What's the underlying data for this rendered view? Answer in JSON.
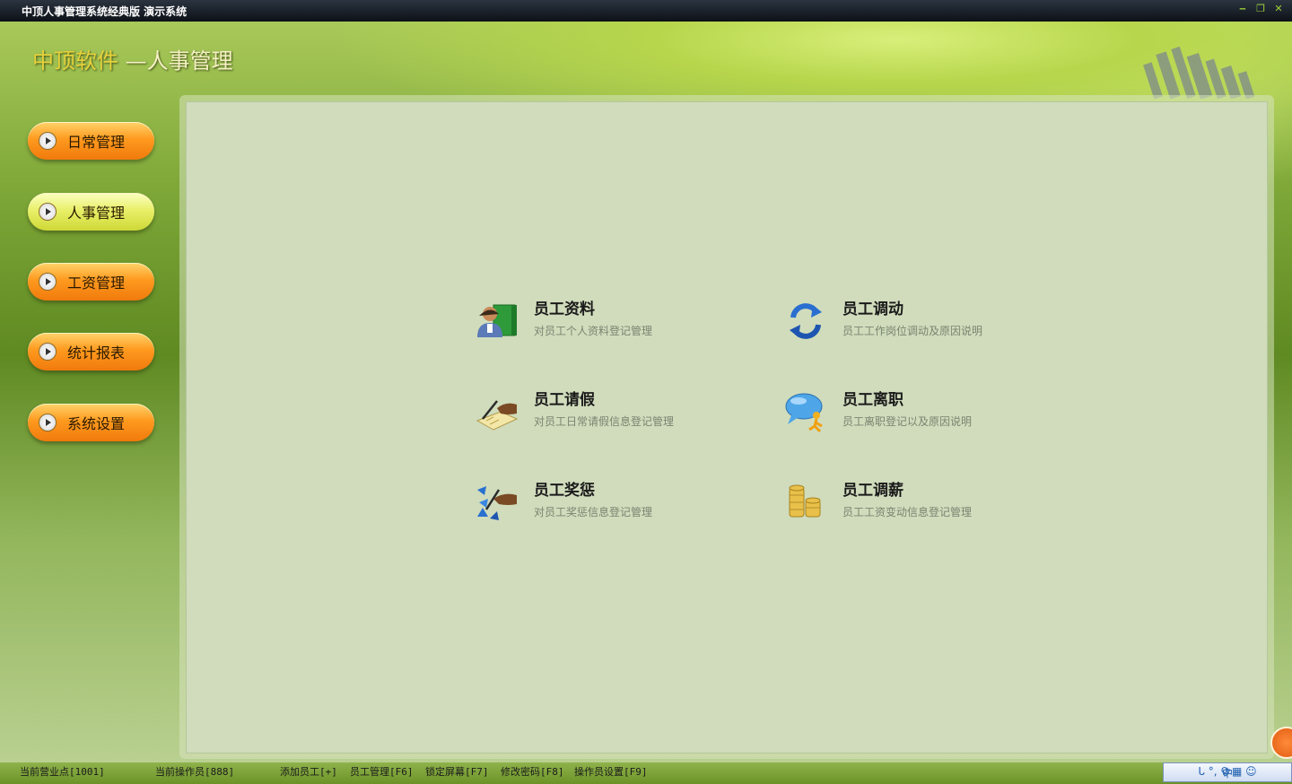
{
  "window": {
    "title": "中顶人事管理系统经典版 演示系统",
    "controls": [
      "‒",
      "❐",
      "✕"
    ]
  },
  "brand": {
    "part1": "中顶软件",
    "part2": " —人事管理"
  },
  "sidebar": {
    "items": [
      {
        "label": "日常管理"
      },
      {
        "label": "人事管理"
      },
      {
        "label": "工资管理"
      },
      {
        "label": "统计报表"
      },
      {
        "label": "系统设置"
      }
    ]
  },
  "modules": [
    {
      "title": "员工资料",
      "desc": "对员工个人资料登记管理",
      "icon": "employee-profile-icon"
    },
    {
      "title": "员工调动",
      "desc": "员工工作岗位调动及原因说明",
      "icon": "refresh-arrows-icon"
    },
    {
      "title": "员工请假",
      "desc": "对员工日常请假信息登记管理",
      "icon": "writing-hand-icon"
    },
    {
      "title": "员工离职",
      "desc": "员工离职登记以及原因说明",
      "icon": "chat-person-icon"
    },
    {
      "title": "员工奖惩",
      "desc": "对员工奖惩信息登记管理",
      "icon": "award-arrows-icon"
    },
    {
      "title": "员工调薪",
      "desc": "员工工资变动信息登记管理",
      "icon": "coins-icon"
    }
  ],
  "statusbar": {
    "outlet": "当前营业点[1001]",
    "operator": "当前操作员[888]",
    "add_employee": "添加员工[+]",
    "manage_employee": "员工管理[F6]",
    "lock_screen": "锁定屏幕[F7]",
    "change_password": "修改密码[F8]",
    "operator_settings": "操作员设置[F9]",
    "ime": {
      "mode": "中",
      "glyphs": "ᒐ °, ⚲ ▦ ☺"
    }
  },
  "colors": {
    "accent_orange": "#ff9a1f",
    "active_yellow": "#e9f06a",
    "panel_bg": "#d0dcbc"
  }
}
